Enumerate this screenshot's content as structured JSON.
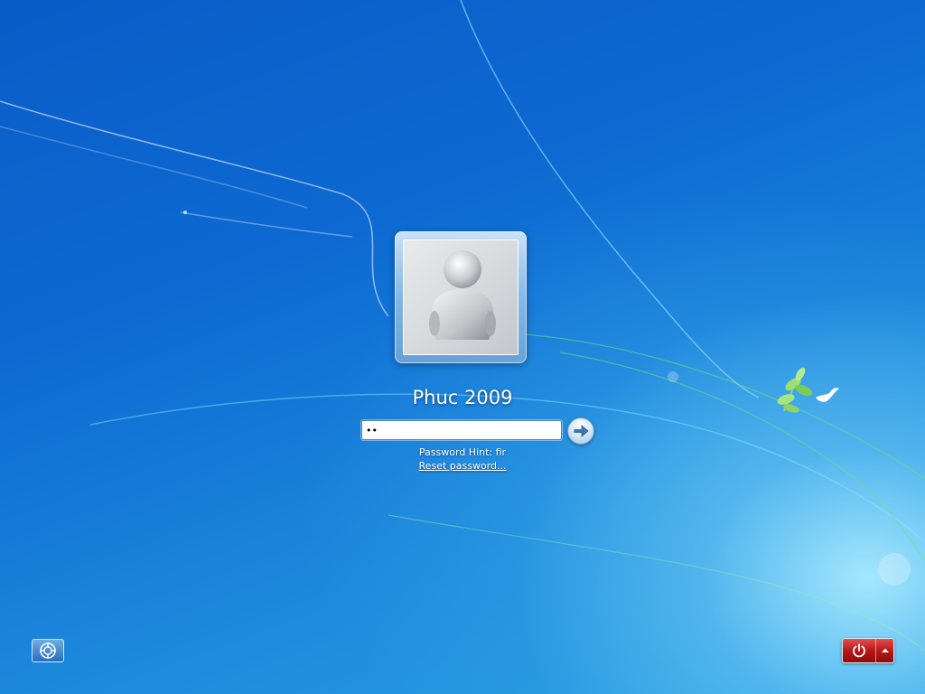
{
  "user": {
    "name": "Phuc 2009",
    "avatar_icon": "user-silhouette-icon"
  },
  "login": {
    "password_value": "••",
    "submit_icon": "arrow-right-icon",
    "hint": "Password Hint: fir",
    "reset_link": "Reset password..."
  },
  "bottom": {
    "ease_of_access_icon": "ease-of-access-icon",
    "power_icon": "power-icon",
    "power_menu_icon": "chevron-up-icon"
  },
  "colors": {
    "background": "#0d6ad2",
    "power_button": "#b81818",
    "text": "#ffffff"
  }
}
